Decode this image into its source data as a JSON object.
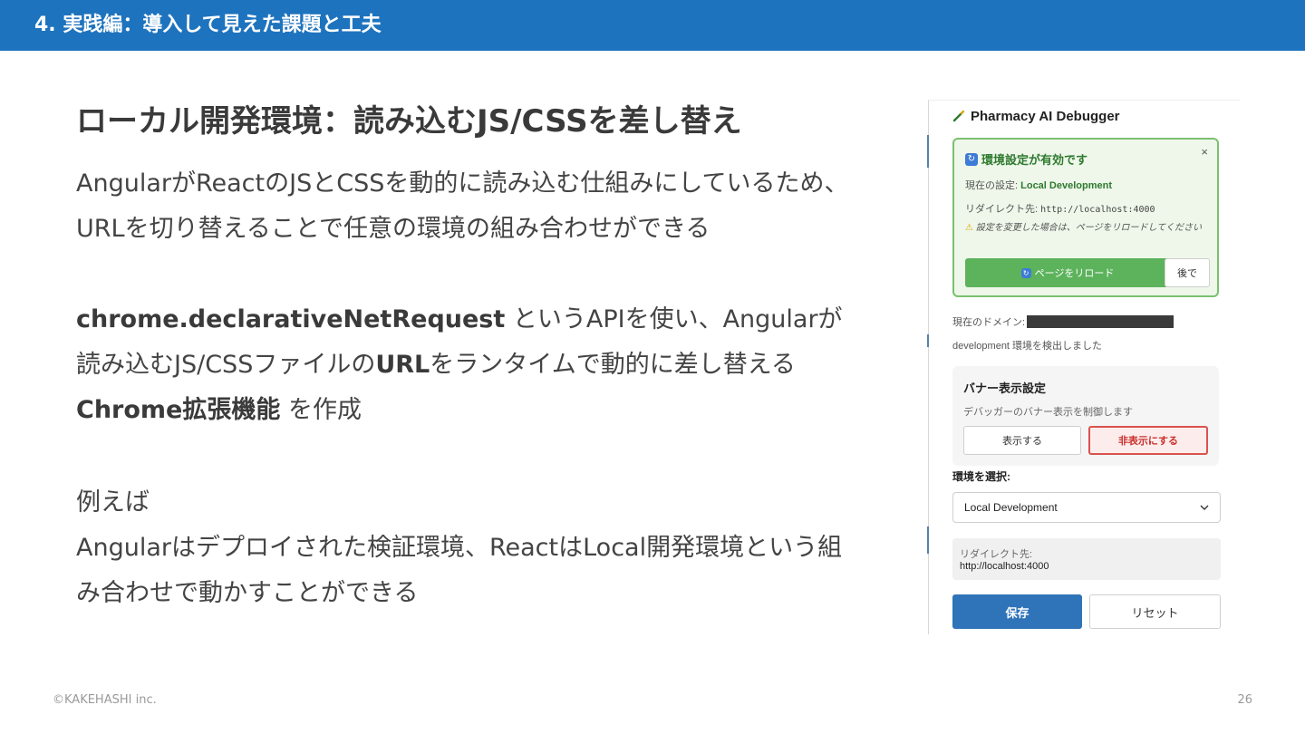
{
  "header": {
    "title": "4. 実践編：導入して見えた課題と工夫"
  },
  "slide": {
    "heading": "ローカル開発環境：読み込むJS/CSSを差し替え",
    "para1": {
      "line1": "AngularがReactのJSとCSSを動的に読み込む仕組みにしているため、",
      "line2": "URLを切り替えることで任意の環境の組み合わせができる"
    },
    "para2": {
      "api_name": "chrome.declarativeNetRequest",
      "line1_rest": " というAPIを使い、Angularが",
      "line2_pre": "読み込むJS/CSSファイルの",
      "line2_bold": "URL",
      "line2_post": "をランタイムで動的に差し替える",
      "line3_bold": "Chrome拡張機能",
      "line3_rest": " を作成"
    },
    "para3": {
      "line1": "例えば",
      "line2": "Angularはデプロイされた検証環境、ReactはLocal開発環境という組",
      "line3": "み合わせで動かすことができる"
    }
  },
  "footer": {
    "copyright": "©KAKEHASHI inc.",
    "page_number": "26"
  },
  "extension": {
    "title": "Pharmacy AI Debugger",
    "title_icon": "pencil-icon",
    "notice": {
      "close": "×",
      "title": "環境設定が有効です",
      "current_label": "現在の設定: ",
      "current_value": "Local Development",
      "redirect_label": "リダイレクト先: ",
      "redirect_value": "http://localhost:4000",
      "warning_icon": "⚠",
      "warning": " 設定を変更した場合は、ページをリロードしてください",
      "reload_button": "ページをリロード",
      "later_button": "後で"
    },
    "domain_label": "現在のドメイン:",
    "detected": "development 環境を検出しました",
    "banner": {
      "title": "バナー表示設定",
      "description": "デバッガーのバナー表示を制御します",
      "show_button": "表示する",
      "hide_button": "非表示にする"
    },
    "env_label": "環境を選択:",
    "env_selected": "Local Development",
    "redirect_box": {
      "label": "リダイレクト先:",
      "url": "http://localhost:4000"
    },
    "save_button": "保存",
    "reset_button": "リセット"
  },
  "colors": {
    "header": "#1e73be",
    "success_border": "#7cc06f",
    "reload": "#5cb35c",
    "danger": "#d9534f",
    "primary": "#2f73b8"
  }
}
